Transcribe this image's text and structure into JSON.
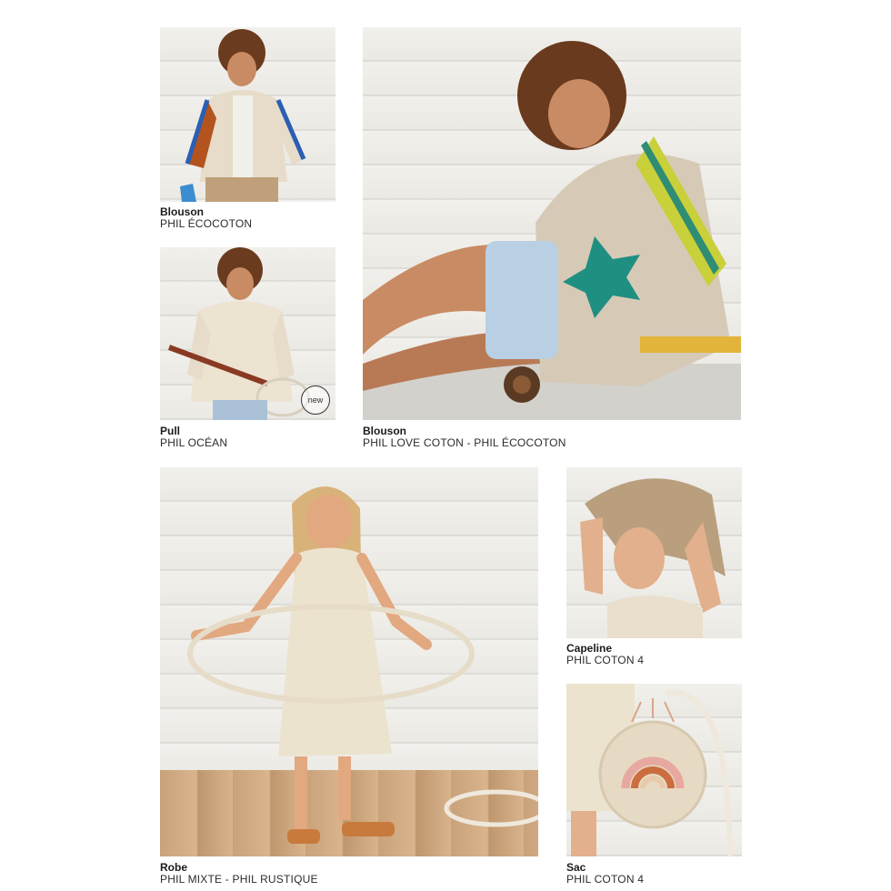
{
  "products": [
    {
      "title": "Blouson",
      "yarn": "PHIL ÉCOCOTON"
    },
    {
      "title": "Pull",
      "yarn": "PHIL OCÉAN",
      "badge": "new"
    },
    {
      "title": "Blouson",
      "yarn": "PHIL LOVE COTON - PHIL ÉCOCOTON"
    },
    {
      "title": "Robe",
      "yarn": "PHIL MIXTE - PHIL RUSTIQUE"
    },
    {
      "title": "Capeline",
      "yarn": "PHIL COTON 4"
    },
    {
      "title": "Sac",
      "yarn": "PHIL COTON 4"
    }
  ]
}
